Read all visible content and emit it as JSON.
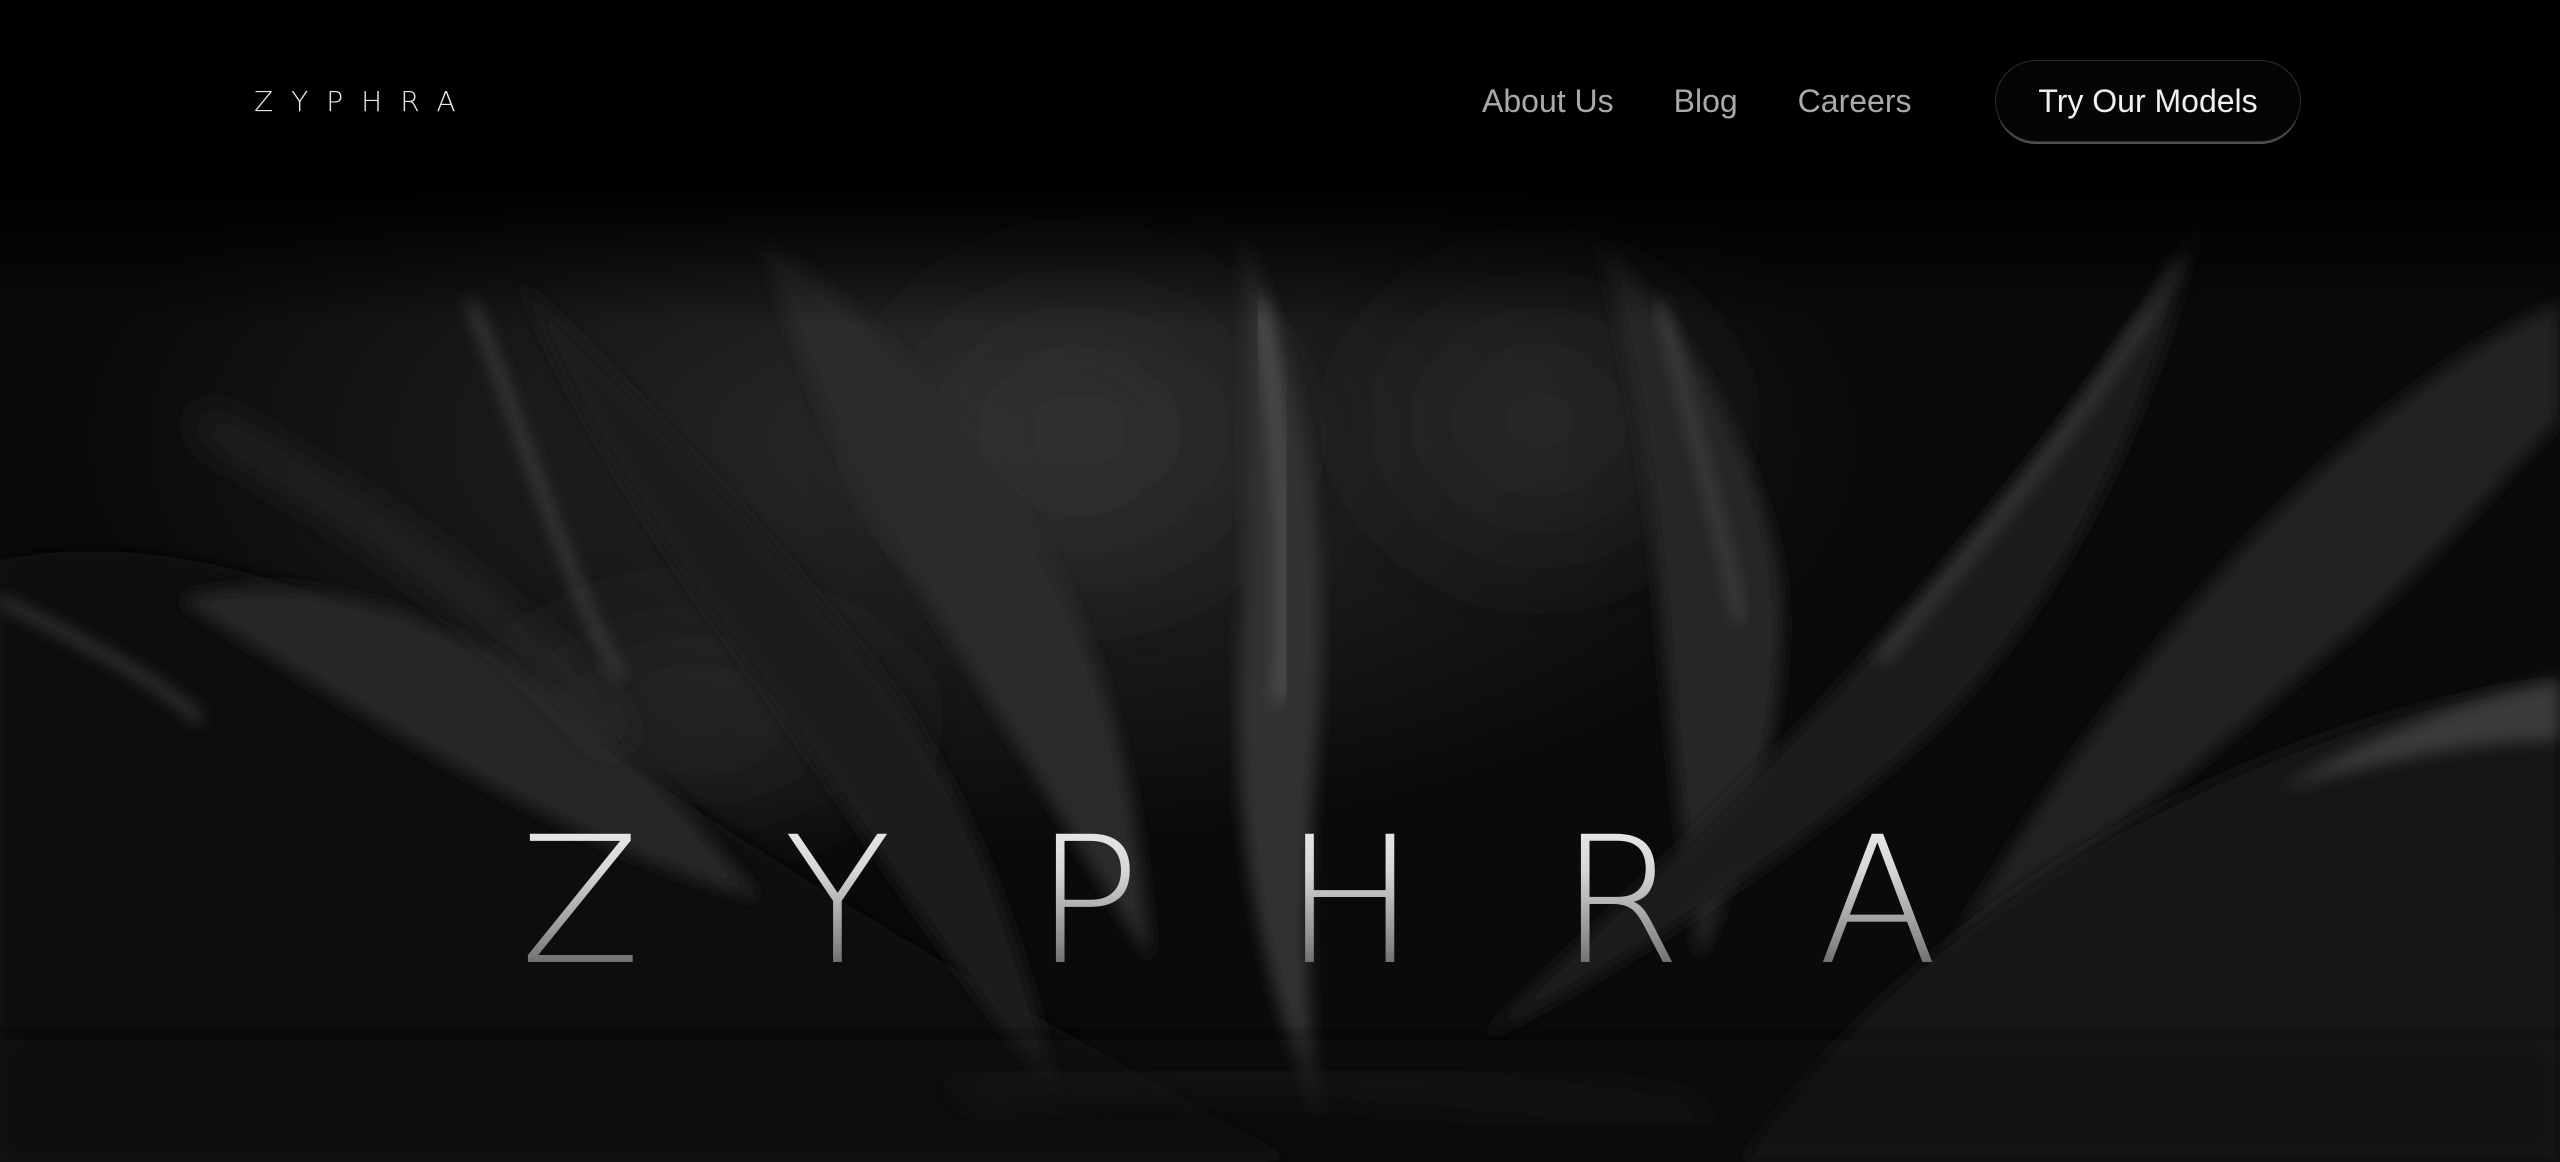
{
  "brand": {
    "logo_text": "ZYPHRA"
  },
  "nav": {
    "links": [
      {
        "label": "About Us"
      },
      {
        "label": "Blog"
      },
      {
        "label": "Careers"
      }
    ],
    "cta_label": "Try Our Models"
  },
  "hero": {
    "title": "ZYPHRA"
  },
  "colors": {
    "background": "#000000",
    "nav_text": "#a9a9a9",
    "cta_text": "#f0f0f0",
    "logo_text": "#e8e8e8"
  },
  "icons": []
}
